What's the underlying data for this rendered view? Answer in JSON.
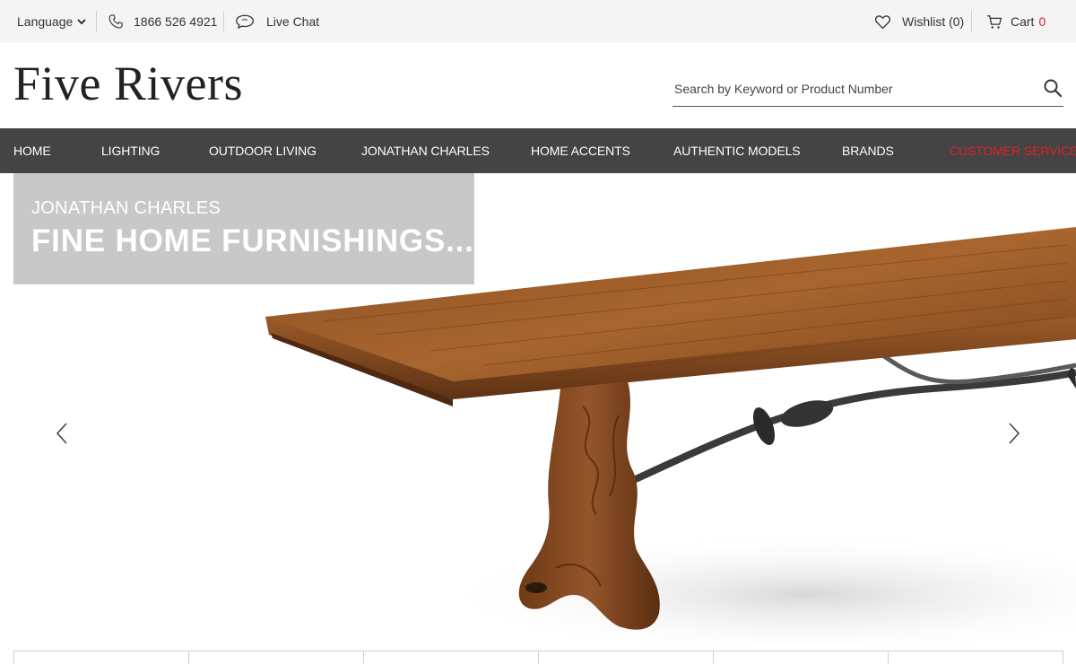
{
  "topbar": {
    "language_label": "Language",
    "phone": "1866 526 4921",
    "chat_label": "Live Chat",
    "wishlist_label": "Wishlist (0)",
    "cart_label": "Cart",
    "cart_count": "0"
  },
  "header": {
    "logo": "Five Rivers",
    "search_placeholder": "Search by Keyword or Product Number"
  },
  "nav": {
    "items": [
      {
        "label": "HOME"
      },
      {
        "label": "LIGHTING"
      },
      {
        "label": "OUTDOOR LIVING"
      },
      {
        "label": "JONATHAN CHARLES"
      },
      {
        "label": "HOME ACCENTS"
      },
      {
        "label": "AUTHENTIC MODELS"
      },
      {
        "label": "BRANDS"
      },
      {
        "label": "CUSTOMER SERVICE"
      }
    ]
  },
  "hero": {
    "caption_small": "JONATHAN CHARLES",
    "caption_big": "FINE HOME FURNISHINGS..."
  },
  "colors": {
    "accent": "#e12026",
    "nav_bg": "#444444",
    "topbar_bg": "#f4f4f4",
    "caption_bg": "#c8c8c8"
  },
  "icons": [
    "chevron-down-icon",
    "phone-icon",
    "chat-bubble-icon",
    "heart-icon",
    "cart-icon",
    "search-icon",
    "chevron-left-icon",
    "chevron-right-icon"
  ]
}
